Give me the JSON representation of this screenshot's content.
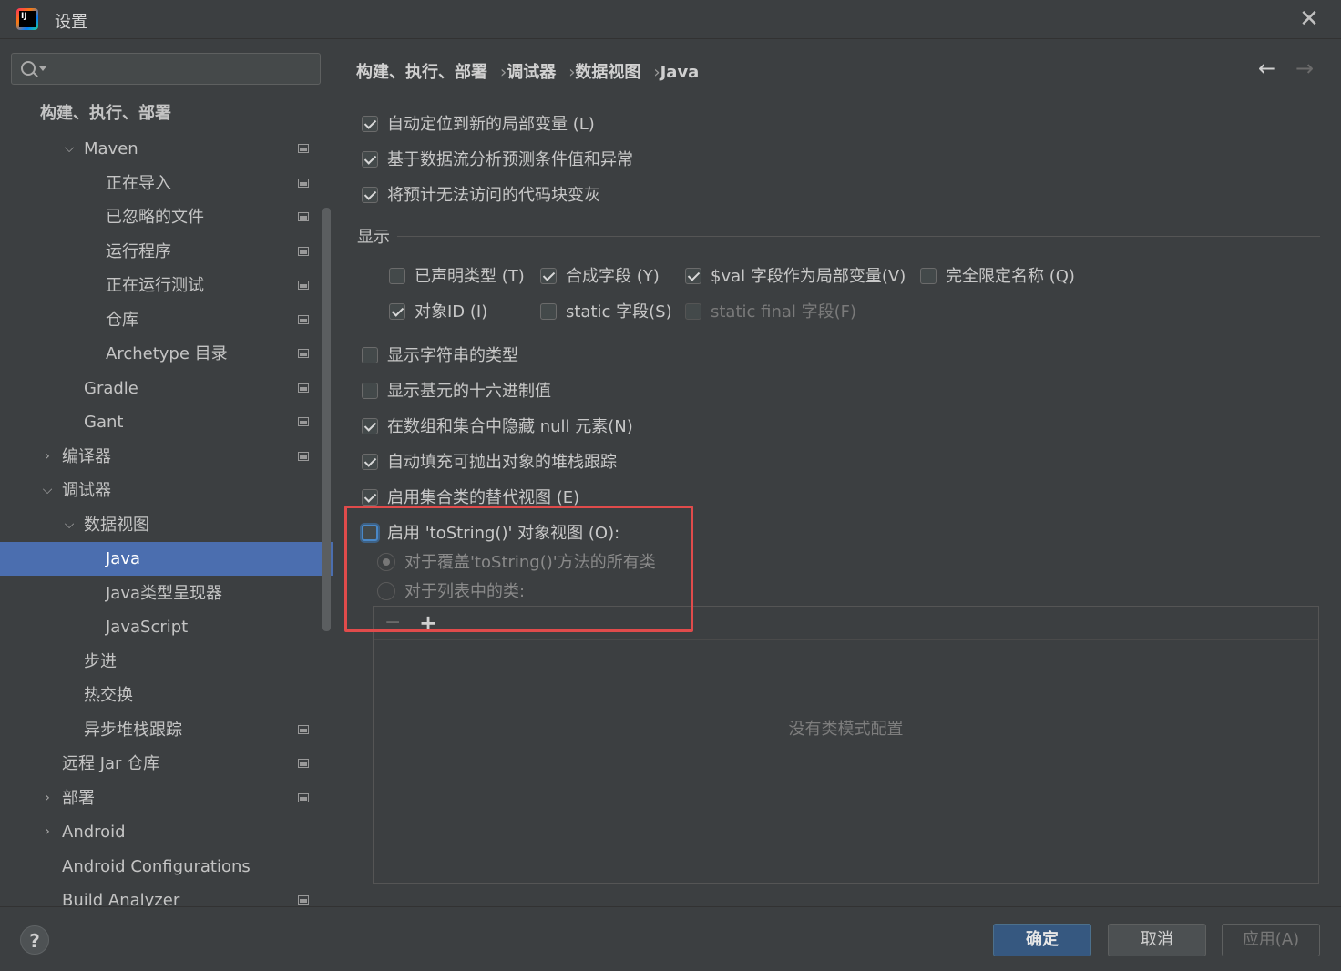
{
  "window": {
    "title": "设置",
    "close_glyph": "✕"
  },
  "search": {
    "placeholder": ""
  },
  "sidebar": {
    "items": [
      {
        "label": "构建、执行、部署"
      },
      {
        "label": "Maven"
      },
      {
        "label": "正在导入"
      },
      {
        "label": "已忽略的文件"
      },
      {
        "label": "运行程序"
      },
      {
        "label": "正在运行测试"
      },
      {
        "label": "仓库"
      },
      {
        "label": "Archetype 目录"
      },
      {
        "label": "Gradle"
      },
      {
        "label": "Gant"
      },
      {
        "label": "编译器"
      },
      {
        "label": "调试器"
      },
      {
        "label": "数据视图"
      },
      {
        "label": "Java"
      },
      {
        "label": "Java类型呈现器"
      },
      {
        "label": "JavaScript"
      },
      {
        "label": "步进"
      },
      {
        "label": "热交换"
      },
      {
        "label": "异步堆栈跟踪"
      },
      {
        "label": "远程 Jar 仓库"
      },
      {
        "label": "部署"
      },
      {
        "label": "Android"
      },
      {
        "label": "Android Configurations"
      },
      {
        "label": "Build Analyzer"
      }
    ]
  },
  "breadcrumb": {
    "parts": [
      "构建、执行、部署",
      "调试器",
      "数据视图",
      "Java"
    ],
    "separator": "›"
  },
  "nav": {
    "back": "←",
    "forward": "→"
  },
  "options": {
    "auto_locate": {
      "label": "自动定位到新的局部变量 (L)",
      "checked": true
    },
    "predict": {
      "label": "基于数据流分析预测条件值和异常",
      "checked": true
    },
    "gray_unreachable": {
      "label": "将预计无法访问的代码块变灰",
      "checked": true
    }
  },
  "display": {
    "section_label": "显示",
    "declared_type": {
      "label": "已声明类型 (T)",
      "checked": false
    },
    "synthetic_fields": {
      "label": "合成字段 (Y)",
      "checked": true
    },
    "val_fields": {
      "label": "$val 字段作为局部变量(V)",
      "checked": true
    },
    "fqn": {
      "label": "完全限定名称 (Q)",
      "checked": false
    },
    "object_id": {
      "label": "对象ID (I)",
      "checked": true
    },
    "static_fields": {
      "label": "static 字段(S)",
      "checked": false
    },
    "static_final_fields": {
      "label": "static final 字段(F)",
      "checked": false
    }
  },
  "options2": {
    "string_type": {
      "label": "显示字符串的类型",
      "checked": false
    },
    "hex": {
      "label": "显示基元的十六进制值",
      "checked": false
    },
    "hide_null": {
      "label": "在数组和集合中隐藏 null 元素(N)",
      "checked": true
    },
    "autofill_stack": {
      "label": "自动填充可抛出对象的堆栈跟踪",
      "checked": true
    },
    "alt_view": {
      "label": "启用集合类的替代视图 (E)",
      "checked": true
    },
    "tostring": {
      "label": "启用 'toString()' 对象视图 (O):",
      "checked": false
    },
    "radio_all": {
      "label": "对于覆盖'toString()'方法的所有类",
      "selected": true
    },
    "radio_list": {
      "label": "对于列表中的类:",
      "selected": false
    }
  },
  "list": {
    "minus": "−",
    "plus": "+",
    "empty_text": "没有类模式配置"
  },
  "footer": {
    "help": "?",
    "ok": "确定",
    "cancel": "取消",
    "apply": "应用(A)"
  },
  "colors": {
    "selection": "#4b6eaf",
    "highlight_box": "#e04b4b",
    "ok_button": "#365880"
  }
}
